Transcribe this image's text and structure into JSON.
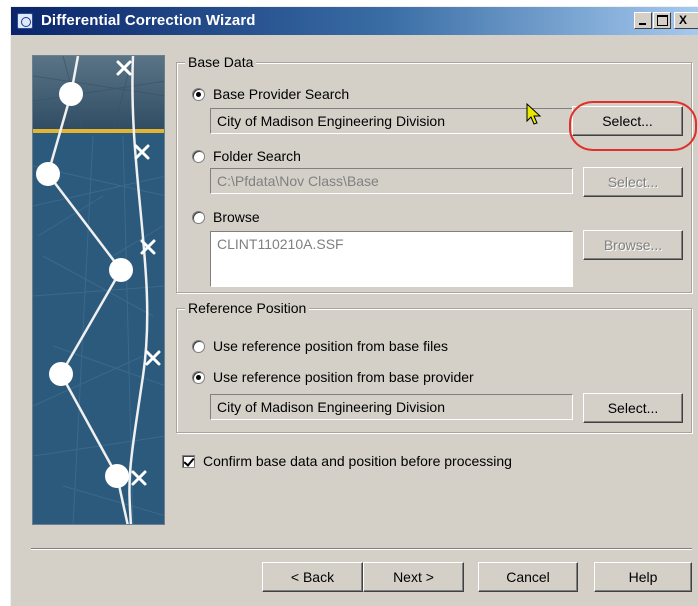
{
  "window": {
    "title": "Differential Correction Wizard"
  },
  "title_controls": {
    "minimize": "",
    "maximize": "",
    "close": "X"
  },
  "base_data": {
    "legend": "Base Data",
    "options": [
      {
        "label": "Base Provider Search",
        "checked": true
      },
      {
        "label": "Folder Search",
        "checked": false
      },
      {
        "label": "Browse",
        "checked": false
      }
    ],
    "provider_value": "City of Madison Engineering Division",
    "provider_select_label": "Select...",
    "folder_value": "C:\\Pfdata\\Nov Class\\Base",
    "folder_select_label": "Select...",
    "browse_value": "CLINT110210A.SSF",
    "browse_button_label": "Browse..."
  },
  "reference_position": {
    "legend": "Reference Position",
    "options": [
      {
        "label": "Use reference position from base files",
        "checked": false
      },
      {
        "label": "Use reference position from base provider",
        "checked": true
      }
    ],
    "provider_value": "City of Madison Engineering Division",
    "select_label": "Select..."
  },
  "confirm": {
    "label": "Confirm base data and position before processing",
    "checked": true
  },
  "footer": {
    "back": "< Back",
    "next": "Next >",
    "cancel": "Cancel",
    "help": "Help"
  },
  "colors": {
    "highlight": "#e0302a",
    "titlebar_start": "#0a246a",
    "face": "#d4d0c8",
    "side_panel": "#2c5574",
    "cursor": "#e8e800"
  }
}
